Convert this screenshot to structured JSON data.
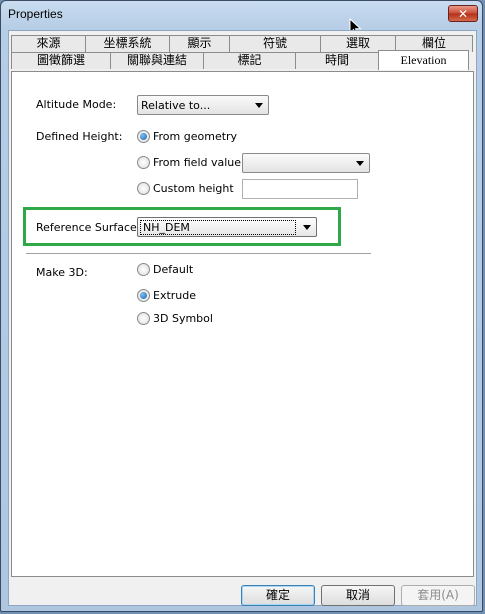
{
  "window": {
    "title": "Properties",
    "close_label": "✕"
  },
  "tabs_row1": [
    "來源",
    "坐標系統",
    "顯示",
    "符號",
    "選取",
    "欄位"
  ],
  "tabs_row2": [
    "圖徵篩選",
    "關聯與連結",
    "標記",
    "時間",
    "Elevation"
  ],
  "active_tab": "Elevation",
  "altitude_mode": {
    "label": "Altitude Mode:",
    "value": "Relative to..."
  },
  "defined_height": {
    "label": "Defined Height:",
    "options": [
      "From geometry",
      "From field value",
      "Custom height"
    ],
    "selected": "From geometry",
    "field_value": "",
    "custom_value": ""
  },
  "reference_surface": {
    "label": "Reference Surface:",
    "value": "NH_DEM",
    "highlight_color": "#2fa84a"
  },
  "make_3d": {
    "label": "Make 3D:",
    "options": [
      "Default",
      "Extrude",
      "3D Symbol"
    ],
    "selected": "Extrude"
  },
  "buttons": {
    "ok": "確定",
    "cancel": "取消",
    "apply": "套用(A)"
  }
}
